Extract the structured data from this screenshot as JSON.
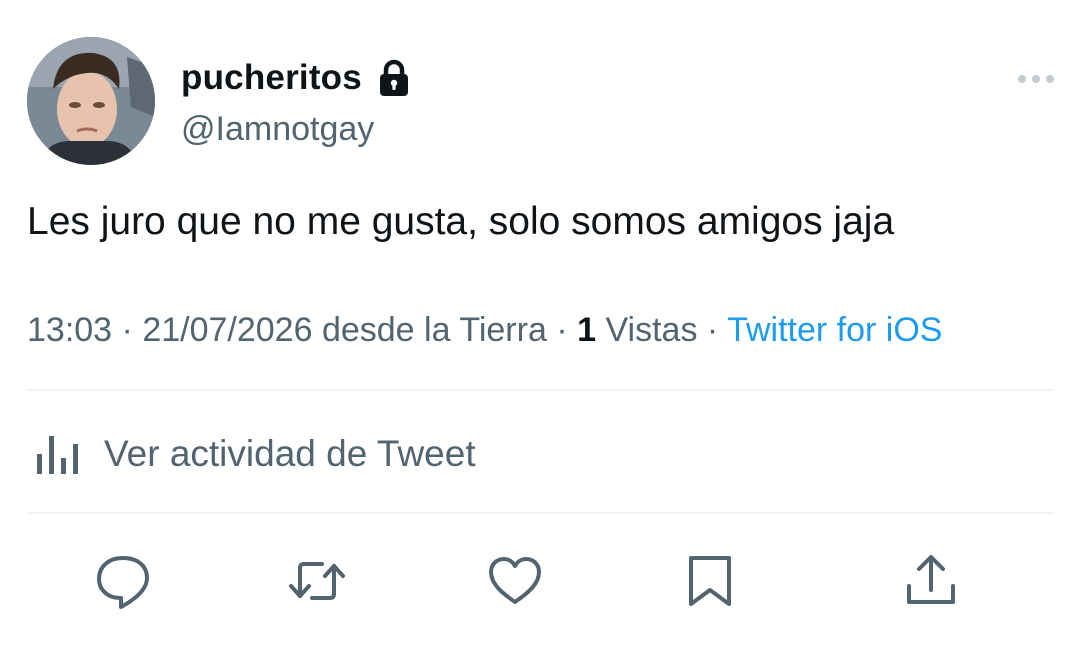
{
  "tweet": {
    "author": {
      "display_name": "pucheritos",
      "handle": "@Iamnotgay",
      "protected_icon": "lock-icon",
      "avatar_icon": "profile-photo"
    },
    "text": "Les juro que no me gusta, solo somos amigos jaja",
    "meta": {
      "time": "13:03",
      "separator": "·",
      "date": "21/07/2026",
      "location": "desde la Tierra",
      "views_count": "1",
      "views_label": "Vistas",
      "source": "Twitter for iOS"
    },
    "activity": {
      "label": "Ver actividad de Tweet",
      "icon": "analytics-bars-icon"
    },
    "actions": [
      {
        "name": "reply",
        "icon": "comment-icon"
      },
      {
        "name": "retweet",
        "icon": "retweet-icon"
      },
      {
        "name": "like",
        "icon": "heart-icon"
      },
      {
        "name": "bookmark",
        "icon": "bookmark-icon"
      },
      {
        "name": "share",
        "icon": "share-icon"
      }
    ]
  },
  "colors": {
    "text_primary": "#0f1419",
    "text_secondary": "#536471",
    "link": "#1d9bf0",
    "divider": "#eff3f4"
  }
}
